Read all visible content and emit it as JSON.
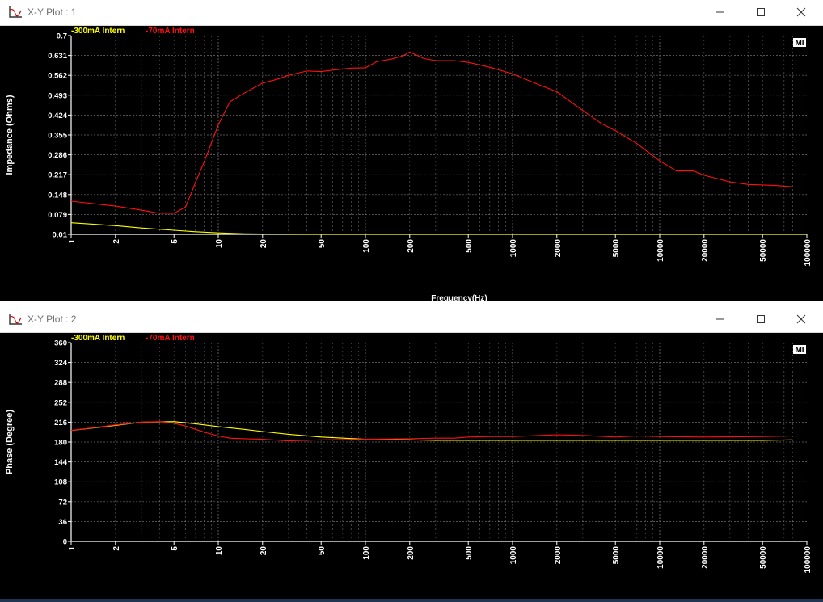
{
  "windows": [
    {
      "title": "X-Y Plot : 1",
      "controls": {
        "minimize": "minimize-icon",
        "maximize": "maximize-icon",
        "close": "close-icon"
      }
    },
    {
      "title": "X-Y Plot : 2",
      "controls": {
        "minimize": "minimize-icon",
        "maximize": "maximize-icon",
        "close": "close-icon"
      }
    }
  ],
  "colors": {
    "yellow": "#ffff00",
    "red": "#ff1010",
    "grid": "#9a9a9a",
    "axis": "#ffffff",
    "background": "#000000"
  },
  "chart_data": [
    {
      "type": "line",
      "xscale": "log",
      "xlabel": "Frequency(Hz)",
      "ylabel": "Impedance (Ohms)",
      "xlim": [
        1,
        100000
      ],
      "ylim": [
        0.01,
        0.7
      ],
      "grid": true,
      "legend_position": "top-left",
      "logo": "MI",
      "xticks": [
        "1",
        "2",
        "5",
        "10",
        "20",
        "50",
        "100",
        "200",
        "500",
        "1000",
        "2000",
        "5000",
        "10000",
        "20000",
        "50000",
        "100000"
      ],
      "yticks": [
        "0.01",
        "0.079",
        "0.148",
        "0.217",
        "0.286",
        "0.355",
        "0.424",
        "0.493",
        "0.562",
        "0.631",
        "0.7"
      ],
      "series": [
        {
          "name": "-300mA Intern",
          "color": "#ffff00",
          "x": [
            1,
            2,
            3,
            5,
            7,
            10,
            15,
            20,
            50,
            100,
            1000,
            100000
          ],
          "y": [
            0.05,
            0.04,
            0.032,
            0.024,
            0.019,
            0.015,
            0.012,
            0.011,
            0.01,
            0.01,
            0.01,
            0.01
          ]
        },
        {
          "name": "-70mA Intern",
          "color": "#ff1010",
          "x": [
            1,
            2,
            3,
            4,
            5,
            6,
            7,
            8,
            10,
            12,
            15,
            20,
            25,
            30,
            40,
            50,
            60,
            80,
            100,
            120,
            150,
            180,
            200,
            250,
            300,
            400,
            500,
            700,
            1000,
            1500,
            2000,
            3000,
            4000,
            5000,
            7000,
            10000,
            13000,
            17000,
            20000,
            30000,
            40000,
            60000,
            80000
          ],
          "y": [
            0.125,
            0.108,
            0.094,
            0.083,
            0.083,
            0.105,
            0.19,
            0.26,
            0.39,
            0.47,
            0.5,
            0.535,
            0.548,
            0.562,
            0.577,
            0.575,
            0.58,
            0.587,
            0.588,
            0.61,
            0.618,
            0.63,
            0.643,
            0.62,
            0.613,
            0.613,
            0.607,
            0.59,
            0.567,
            0.53,
            0.505,
            0.44,
            0.395,
            0.37,
            0.325,
            0.265,
            0.23,
            0.23,
            0.215,
            0.192,
            0.183,
            0.18,
            0.175
          ]
        }
      ]
    },
    {
      "type": "line",
      "xscale": "log",
      "xlabel": "",
      "ylabel": "Phase (Degree)",
      "xlim": [
        1,
        100000
      ],
      "ylim": [
        0,
        360
      ],
      "grid": true,
      "legend_position": "top-left",
      "logo": "MI",
      "xticks": [
        "1",
        "2",
        "5",
        "10",
        "20",
        "50",
        "100",
        "200",
        "500",
        "1000",
        "2000",
        "5000",
        "10000",
        "20000",
        "50000",
        "100000"
      ],
      "yticks": [
        "0",
        "36",
        "72",
        "108",
        "144",
        "180",
        "216",
        "252",
        "288",
        "324",
        "360"
      ],
      "series": [
        {
          "name": "-300mA Intern",
          "color": "#ffff00",
          "x": [
            1,
            2,
            3,
            5,
            7,
            10,
            15,
            20,
            30,
            50,
            100,
            200,
            300,
            500,
            1000,
            2000,
            5000,
            10000,
            20000,
            50000,
            80000
          ],
          "y": [
            201,
            210,
            216,
            217,
            213,
            208,
            203,
            199,
            194,
            189,
            185,
            184,
            183,
            183,
            183,
            183,
            183,
            183,
            183,
            183,
            184
          ]
        },
        {
          "name": "-70mA Intern",
          "color": "#ff1010",
          "x": [
            1,
            2,
            3,
            4,
            5,
            6,
            8,
            10,
            12,
            15,
            20,
            30,
            50,
            100,
            200,
            300,
            400,
            500,
            700,
            1000,
            2000,
            3000,
            5000,
            7000,
            10000,
            20000,
            50000,
            80000
          ],
          "y": [
            201,
            211,
            216,
            217,
            214,
            209,
            198,
            191,
            187,
            186,
            185,
            182,
            184,
            185,
            186,
            187,
            187,
            189,
            190,
            190,
            193,
            192,
            189,
            191,
            190,
            189,
            190,
            191
          ]
        }
      ]
    }
  ]
}
